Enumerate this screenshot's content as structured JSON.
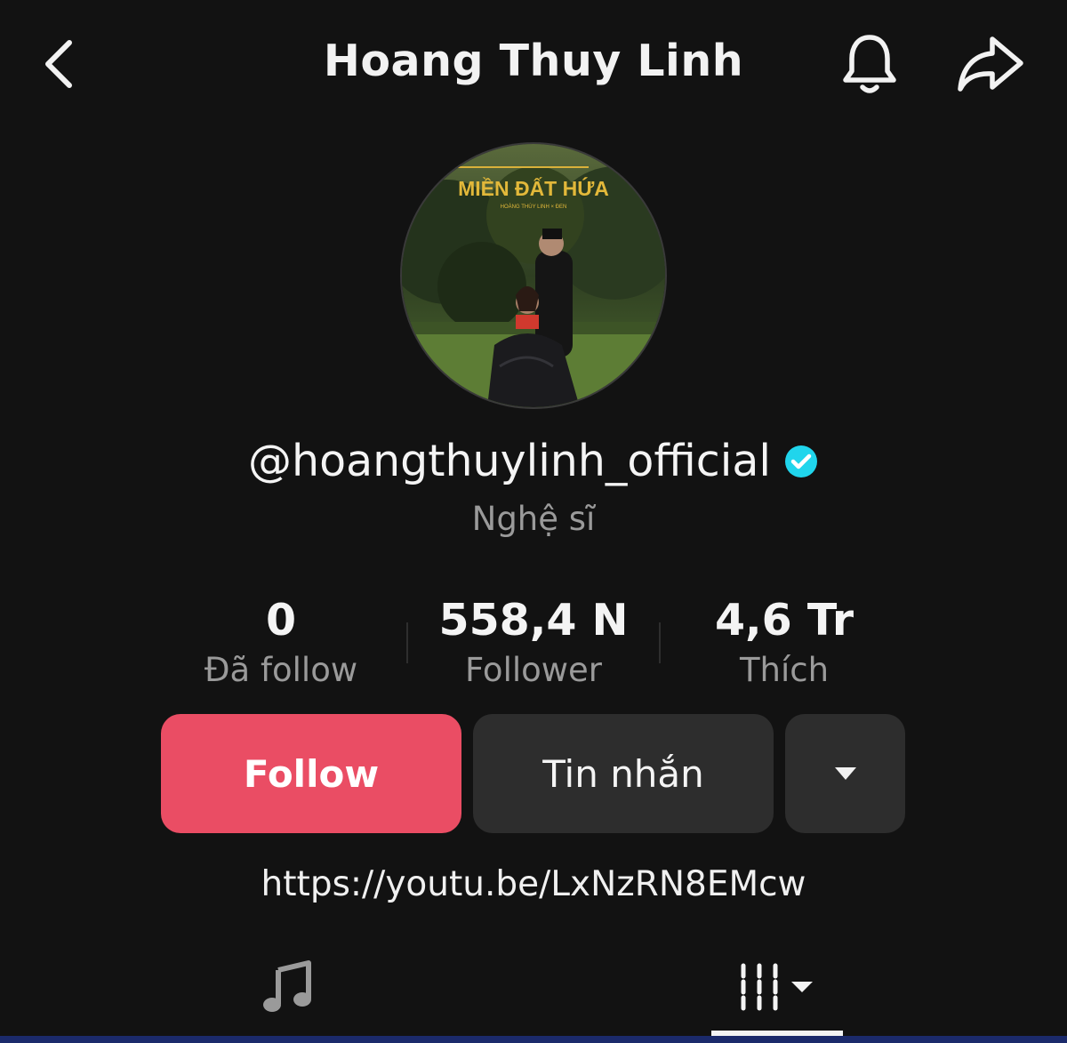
{
  "header": {
    "title": "Hoang Thuy Linh",
    "back_icon": "chevron-left-icon",
    "notification_icon": "bell-icon",
    "share_icon": "share-arrow-icon"
  },
  "profile": {
    "avatar_text": "MIỀN ĐẤT HỨA",
    "avatar_subtext": "HOÀNG THÙY LINH × ĐEN",
    "username": "@hoangthuylinh_official",
    "verified": true,
    "category": "Nghệ sĩ"
  },
  "stats": [
    {
      "value": "0",
      "label": "Đã follow"
    },
    {
      "value": "558,4 N",
      "label": "Follower"
    },
    {
      "value": "4,6 Tr",
      "label": "Thích"
    }
  ],
  "actions": {
    "follow_label": "Follow",
    "message_label": "Tin nhắn",
    "more_icon": "caret-down-icon"
  },
  "bio_link": "https://youtu.be/LxNzRN8EMcw",
  "tabs": [
    {
      "icon": "music-note-icon"
    },
    {
      "icon": "grid-dropdown-icon",
      "active": true
    }
  ],
  "colors": {
    "background": "#121212",
    "follow_button": "#ea4d64",
    "secondary_button": "#2d2d2d",
    "verified_badge": "#20d5ec"
  }
}
